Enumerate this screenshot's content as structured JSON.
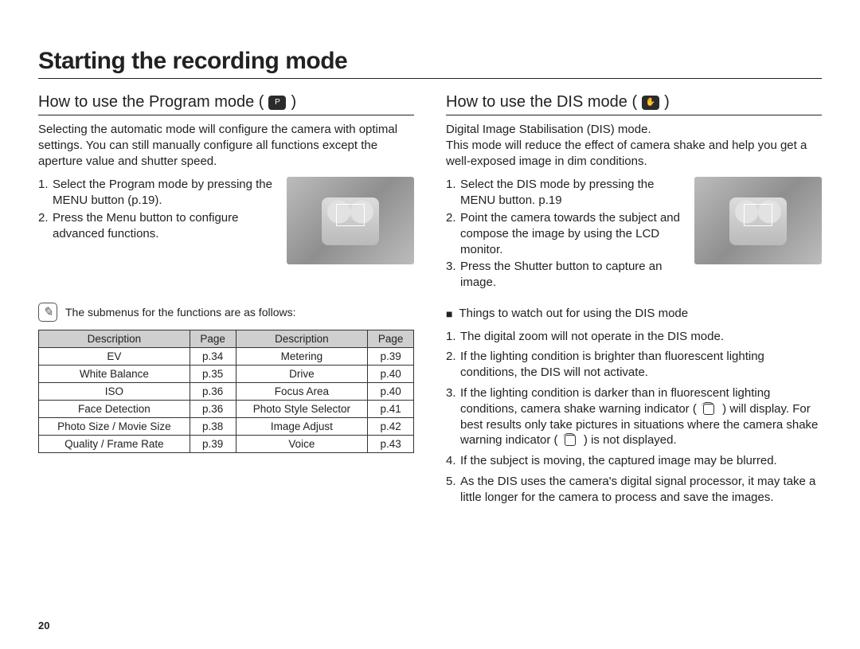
{
  "page_number": "20",
  "title": "Starting the recording mode",
  "left": {
    "heading_prefix": "How to use the Program mode (",
    "heading_suffix": ")",
    "mode_icon_label": "P",
    "intro": "Selecting the automatic mode will configure the camera with optimal settings. You can still manually configure all functions except the aperture value and shutter speed.",
    "steps": [
      "Select the Program mode by pressing the MENU button (p.19).",
      "Press the Menu button to configure advanced functions."
    ],
    "note": "The submenus for the functions are as follows:",
    "table_headers": [
      "Description",
      "Page",
      "Description",
      "Page"
    ],
    "table_rows": [
      [
        "EV",
        "p.34",
        "Metering",
        "p.39"
      ],
      [
        "White Balance",
        "p.35",
        "Drive",
        "p.40"
      ],
      [
        "ISO",
        "p.36",
        "Focus Area",
        "p.40"
      ],
      [
        "Face Detection",
        "p.36",
        "Photo Style Selector",
        "p.41"
      ],
      [
        "Photo Size / Movie Size",
        "p.38",
        "Image Adjust",
        "p.42"
      ],
      [
        "Quality / Frame Rate",
        "p.39",
        "Voice",
        "p.43"
      ]
    ]
  },
  "right": {
    "heading_prefix": "How to use the DIS mode (",
    "heading_suffix": ")",
    "mode_icon_label": "✋",
    "intro_line1": "Digital Image Stabilisation (DIS) mode.",
    "intro_line2": "This mode will reduce the effect of camera shake and help you get a well-exposed image in dim conditions.",
    "steps": [
      "Select the DIS mode by pressing the MENU button. p.19",
      "Point the camera towards the subject and compose the image by using the LCD monitor.",
      "Press the Shutter button to capture an image."
    ],
    "watch_heading": "Things to watch out for using the DIS mode",
    "watch_items": [
      "The digital zoom will not operate in the DIS mode.",
      "If the lighting condition is brighter than fluorescent lighting conditions, the DIS will not activate.",
      {
        "pre": "If the lighting condition is darker than in fluorescent lighting conditions, camera shake warning indicator (",
        "mid": ") will display. For best results only take pictures in situations where the camera shake warning indicator (",
        "post": ") is not displayed."
      },
      "If the subject is moving, the captured image may be blurred.",
      "As the DIS uses the camera's digital signal processor, it may take a little longer for the camera to process and save the images."
    ]
  }
}
